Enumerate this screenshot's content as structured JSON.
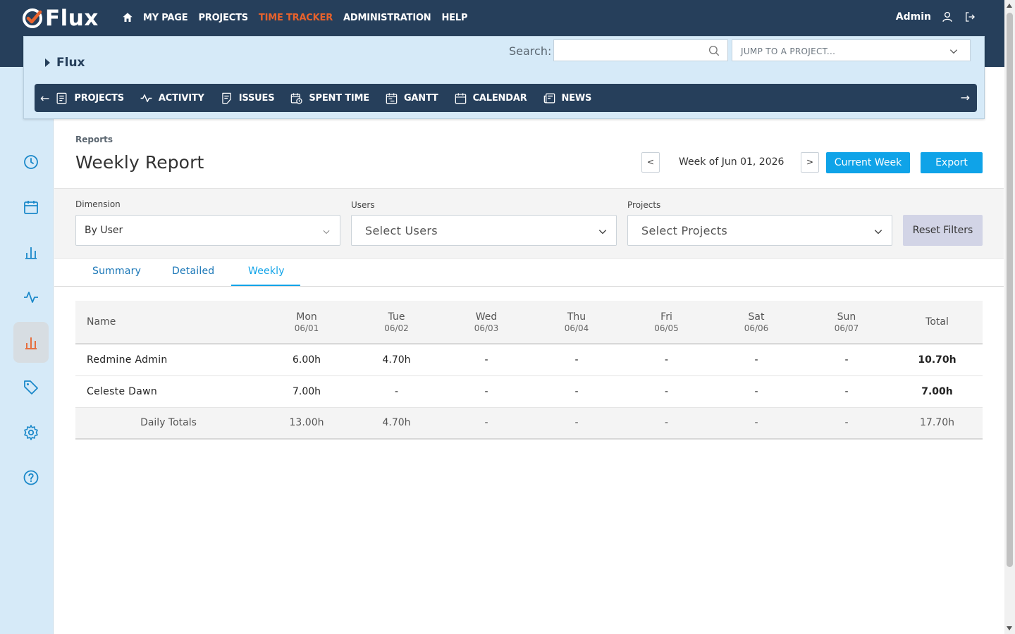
{
  "app": {
    "logo_text": "Flux",
    "menu": [
      "MY PAGE",
      "PROJECTS",
      "TIME TRACKER",
      "ADMINISTRATION",
      "HELP"
    ],
    "active_menu": "TIME TRACKER",
    "user": "Admin",
    "accent_color": "#e8622c",
    "primary_color": "#0fa3e8",
    "navy_color": "#263f5b"
  },
  "project": {
    "title": "Flux",
    "search_label": "Search:",
    "search_value": "",
    "jump_placeholder": "JUMP TO A PROJECT...",
    "menu": [
      {
        "label": "PROJECTS",
        "icon": "projects-icon"
      },
      {
        "label": "ACTIVITY",
        "icon": "activity-icon"
      },
      {
        "label": "ISSUES",
        "icon": "issues-icon"
      },
      {
        "label": "SPENT TIME",
        "icon": "spent-time-icon"
      },
      {
        "label": "GANTT",
        "icon": "gantt-icon"
      },
      {
        "label": "CALENDAR",
        "icon": "calendar-icon"
      },
      {
        "label": "NEWS",
        "icon": "news-icon"
      }
    ]
  },
  "sidebar": {
    "items": [
      "clock-icon",
      "calendar-icon",
      "bar-chart-icon",
      "activity-icon",
      "reports-icon",
      "tag-icon",
      "gear-icon",
      "help-icon"
    ],
    "active": "reports-icon"
  },
  "report": {
    "breadcrumb": "Reports",
    "title": "Weekly Report",
    "prev_label": "<",
    "next_label": ">",
    "week_label": "Week of Jun 01, 2026",
    "current_week_label": "Current Week",
    "export_label": "Export"
  },
  "filters": {
    "dimension_label": "Dimension",
    "dimension_value": "By User",
    "users_label": "Users",
    "users_placeholder": "Select Users",
    "projects_label": "Projects",
    "projects_placeholder": "Select Projects",
    "reset_label": "Reset Filters"
  },
  "tabs": {
    "summary": "Summary",
    "detailed": "Detailed",
    "weekly": "Weekly",
    "active": "Weekly"
  },
  "table": {
    "name_header": "Name",
    "total_header": "Total",
    "days": [
      {
        "day": "Mon",
        "date": "06/01"
      },
      {
        "day": "Tue",
        "date": "06/02"
      },
      {
        "day": "Wed",
        "date": "06/03"
      },
      {
        "day": "Thu",
        "date": "06/04"
      },
      {
        "day": "Fri",
        "date": "06/05"
      },
      {
        "day": "Sat",
        "date": "06/06"
      },
      {
        "day": "Sun",
        "date": "06/07"
      }
    ],
    "rows": [
      {
        "name": "Redmine Admin",
        "hours": [
          "6.00h",
          "4.70h",
          "-",
          "-",
          "-",
          "-",
          "-"
        ],
        "total": "10.70h"
      },
      {
        "name": "Celeste Dawn",
        "hours": [
          "7.00h",
          "-",
          "-",
          "-",
          "-",
          "-",
          "-"
        ],
        "total": "7.00h"
      }
    ],
    "totals": {
      "label": "Daily Totals",
      "hours": [
        "13.00h",
        "4.70h",
        "-",
        "-",
        "-",
        "-",
        "-"
      ],
      "total": "17.70h"
    }
  }
}
